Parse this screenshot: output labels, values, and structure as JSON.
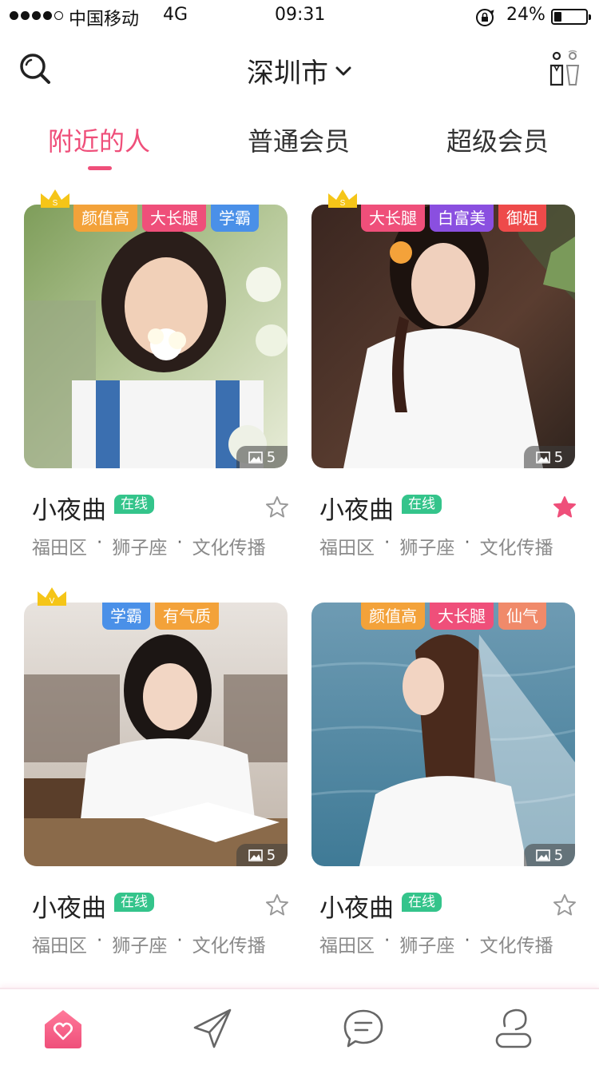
{
  "status_bar": {
    "carrier": "中国移动",
    "network": "4G",
    "time": "09:31",
    "battery": "24%",
    "battery_level": 0.24,
    "signal_bars_filled": 4,
    "signal_bars_total": 5
  },
  "nav": {
    "city": "深圳市",
    "search_icon": "search-icon",
    "right_icon": "couple-icon"
  },
  "tabs": [
    {
      "label": "附近的人",
      "active": true
    },
    {
      "label": "普通会员",
      "active": false
    },
    {
      "label": "超级会员",
      "active": false
    }
  ],
  "colors": {
    "accent": "#ef4f7a",
    "online": "#34c48b",
    "crown": "#f5c518",
    "favorite_active": "#ef4f7a"
  },
  "cards": [
    {
      "name": "小夜曲",
      "online_label": "在线",
      "district": "福田区",
      "zodiac": "狮子座",
      "industry": "文化传播",
      "photo_count": "5",
      "crown": "S",
      "favorited": false,
      "tags": [
        {
          "label": "颜值高",
          "color": "#f3a23a"
        },
        {
          "label": "大长腿",
          "color": "#ef4f7a"
        },
        {
          "label": "学霸",
          "color": "#4a90e8"
        }
      ]
    },
    {
      "name": "小夜曲",
      "online_label": "在线",
      "district": "福田区",
      "zodiac": "狮子座",
      "industry": "文化传播",
      "photo_count": "5",
      "crown": "S",
      "favorited": true,
      "tags": [
        {
          "label": "大长腿",
          "color": "#ef4f7a"
        },
        {
          "label": "白富美",
          "color": "#8a4fe0"
        },
        {
          "label": "御姐",
          "color": "#ee4a4a"
        }
      ]
    },
    {
      "name": "小夜曲",
      "online_label": "在线",
      "district": "福田区",
      "zodiac": "狮子座",
      "industry": "文化传播",
      "photo_count": "5",
      "crown": "V",
      "favorited": false,
      "tags": [
        {
          "label": "学霸",
          "color": "#4a90e8"
        },
        {
          "label": "有气质",
          "color": "#f3a23a"
        }
      ]
    },
    {
      "name": "小夜曲",
      "online_label": "在线",
      "district": "福田区",
      "zodiac": "狮子座",
      "industry": "文化传播",
      "photo_count": "5",
      "crown": "",
      "favorited": false,
      "tags": [
        {
          "label": "颜值高",
          "color": "#f3a23a"
        },
        {
          "label": "大长腿",
          "color": "#ef4f7a"
        },
        {
          "label": "仙气",
          "color": "#f08a6a"
        }
      ]
    }
  ],
  "tabbar": [
    {
      "icon": "home-heart-icon",
      "active": true
    },
    {
      "icon": "paper-plane-icon",
      "active": false
    },
    {
      "icon": "chat-bubble-icon",
      "active": false
    },
    {
      "icon": "profile-icon",
      "active": false
    }
  ]
}
